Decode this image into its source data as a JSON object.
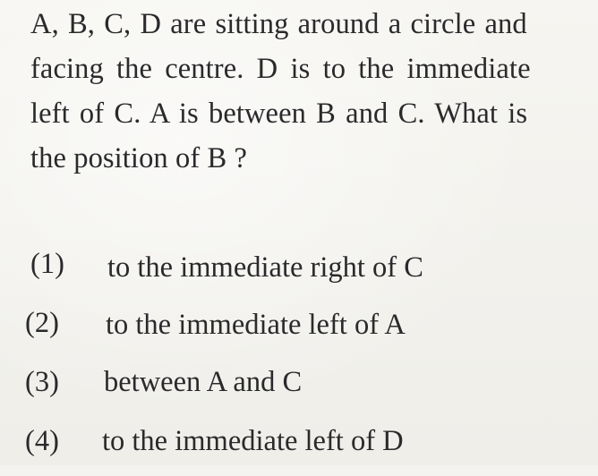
{
  "question": {
    "line1": "A, B, C, D are sitting around a circle and",
    "line2": "facing the centre.  D is to the immediate",
    "line3": "left of C.  A is between B and C.  What is",
    "line4": "the position of B ?"
  },
  "options": [
    {
      "number": "(1)",
      "text": "to the immediate right of C"
    },
    {
      "number": "(2)",
      "text": "to the immediate left of A"
    },
    {
      "number": "(3)",
      "text": "between A and C"
    },
    {
      "number": "(4)",
      "text": "to the immediate left of D"
    }
  ]
}
